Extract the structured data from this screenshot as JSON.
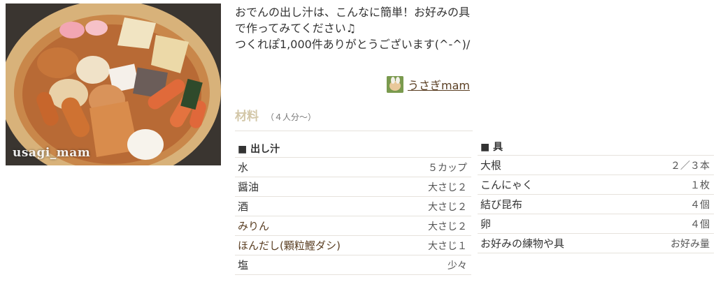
{
  "photo": {
    "watermark": "usagi_mam",
    "alt_subject": "oden-pot-photo"
  },
  "description": {
    "line1": "おでんの出し汁は、こんなに簡単！お好みの具で作ってみてください♫",
    "line2": "つくれぽ1,000件ありがとうございます(^-^)/"
  },
  "author": {
    "name": "うさぎmam"
  },
  "ingredients": {
    "title": "材料",
    "servings": "（４人分〜）",
    "groups": [
      {
        "heading": "■ 出し汁",
        "items": [
          {
            "name": "水",
            "qty": "５カップ",
            "link": false
          },
          {
            "name": "醤油",
            "qty": "大さじ２",
            "link": false
          },
          {
            "name": "酒",
            "qty": "大さじ２",
            "link": false
          },
          {
            "name": "みりん",
            "qty": "大さじ２",
            "link": true
          },
          {
            "name": "ほんだし(顆粒鰹ダシ)",
            "qty": "大さじ１",
            "link": true
          },
          {
            "name": "塩",
            "qty": "少々",
            "link": false
          }
        ]
      },
      {
        "heading": "■ 具",
        "items": [
          {
            "name": "大根",
            "qty": "２／３本",
            "link": false
          },
          {
            "name": "こんにゃく",
            "qty": "１枚",
            "link": false
          },
          {
            "name": "結び昆布",
            "qty": "４個",
            "link": false
          },
          {
            "name": "卵",
            "qty": "４個",
            "link": false
          },
          {
            "name": "お好みの練物や具",
            "qty": "お好み量",
            "link": false
          }
        ]
      }
    ]
  }
}
